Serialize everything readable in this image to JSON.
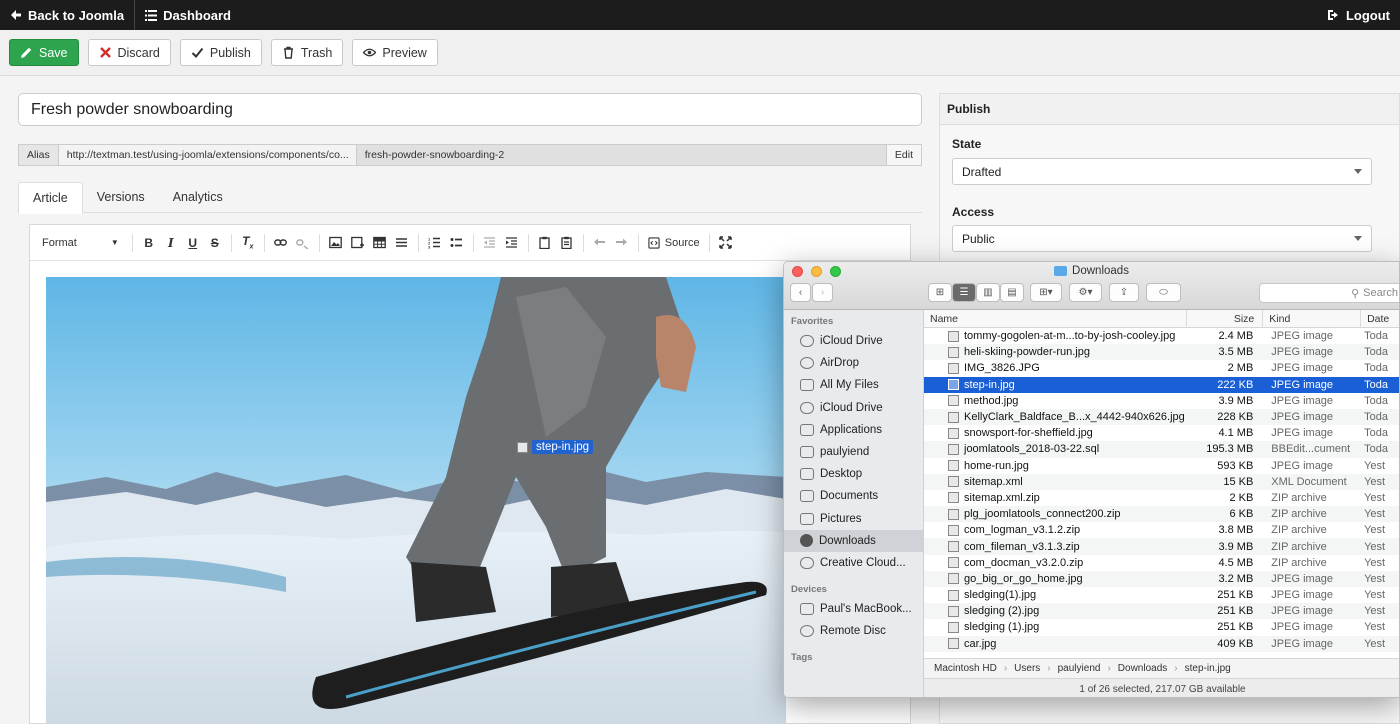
{
  "topbar": {
    "back_label": "Back to Joomla",
    "dashboard_label": "Dashboard",
    "logout_label": "Logout"
  },
  "toolbar": {
    "save_label": "Save",
    "discard_label": "Discard",
    "publish_label": "Publish",
    "trash_label": "Trash",
    "preview_label": "Preview"
  },
  "article": {
    "title": "Fresh powder snowboarding",
    "alias_label": "Alias",
    "alias_url": "http://textman.test/using-joomla/extensions/components/co...",
    "alias_slug": "fresh-powder-snowboarding-2",
    "alias_edit": "Edit"
  },
  "tabs": [
    "Article",
    "Versions",
    "Analytics"
  ],
  "editor": {
    "format_label": "Format",
    "source_label": "Source",
    "drag_file": "step-in.jpg"
  },
  "publish_panel": {
    "heading": "Publish",
    "state_label": "State",
    "state_value": "Drafted",
    "access_label": "Access",
    "access_value": "Public"
  },
  "finder": {
    "title": "Downloads",
    "search_placeholder": "Search",
    "sidebar_favorites": "Favorites",
    "sidebar_devices": "Devices",
    "sidebar_tags": "Tags",
    "favorites": [
      "iCloud Drive",
      "AirDrop",
      "All My Files",
      "iCloud Drive",
      "Applications",
      "paulyiend",
      "Desktop",
      "Documents",
      "Pictures",
      "Downloads",
      "Creative Cloud..."
    ],
    "devices": [
      "Paul's MacBook...",
      "Remote Disc"
    ],
    "columns": {
      "name": "Name",
      "size": "Size",
      "kind": "Kind",
      "date": "Date"
    },
    "files": [
      {
        "name": "tommy-gogolen-at-m...to-by-josh-cooley.jpg",
        "size": "2.4 MB",
        "kind": "JPEG image",
        "date": "Toda"
      },
      {
        "name": "heli-skiing-powder-run.jpg",
        "size": "3.5 MB",
        "kind": "JPEG image",
        "date": "Toda"
      },
      {
        "name": "IMG_3826.JPG",
        "size": "2 MB",
        "kind": "JPEG image",
        "date": "Toda"
      },
      {
        "name": "step-in.jpg",
        "size": "222 KB",
        "kind": "JPEG image",
        "date": "Toda"
      },
      {
        "name": "method.jpg",
        "size": "3.9 MB",
        "kind": "JPEG image",
        "date": "Toda"
      },
      {
        "name": "KellyClark_Baldface_B...x_4442-940x626.jpg",
        "size": "228 KB",
        "kind": "JPEG image",
        "date": "Toda"
      },
      {
        "name": "snowsport-for-sheffield.jpg",
        "size": "4.1 MB",
        "kind": "JPEG image",
        "date": "Toda"
      },
      {
        "name": "joomlatools_2018-03-22.sql",
        "size": "195.3 MB",
        "kind": "BBEdit...cument",
        "date": "Toda"
      },
      {
        "name": "home-run.jpg",
        "size": "593 KB",
        "kind": "JPEG image",
        "date": "Yest"
      },
      {
        "name": "sitemap.xml",
        "size": "15 KB",
        "kind": "XML Document",
        "date": "Yest"
      },
      {
        "name": "sitemap.xml.zip",
        "size": "2 KB",
        "kind": "ZIP archive",
        "date": "Yest"
      },
      {
        "name": "plg_joomlatools_connect200.zip",
        "size": "6 KB",
        "kind": "ZIP archive",
        "date": "Yest"
      },
      {
        "name": "com_logman_v3.1.2.zip",
        "size": "3.8 MB",
        "kind": "ZIP archive",
        "date": "Yest"
      },
      {
        "name": "com_fileman_v3.1.3.zip",
        "size": "3.9 MB",
        "kind": "ZIP archive",
        "date": "Yest"
      },
      {
        "name": "com_docman_v3.2.0.zip",
        "size": "4.5 MB",
        "kind": "ZIP archive",
        "date": "Yest"
      },
      {
        "name": "go_big_or_go_home.jpg",
        "size": "3.2 MB",
        "kind": "JPEG image",
        "date": "Yest"
      },
      {
        "name": "sledging(1).jpg",
        "size": "251 KB",
        "kind": "JPEG image",
        "date": "Yest"
      },
      {
        "name": "sledging (2).jpg",
        "size": "251 KB",
        "kind": "JPEG image",
        "date": "Yest"
      },
      {
        "name": "sledging (1).jpg",
        "size": "251 KB",
        "kind": "JPEG image",
        "date": "Yest"
      },
      {
        "name": "car.jpg",
        "size": "409 KB",
        "kind": "JPEG image",
        "date": "Yest"
      }
    ],
    "selected_index": 3,
    "path": [
      "Macintosh HD",
      "Users",
      "paulyiend",
      "Downloads",
      "step-in.jpg"
    ],
    "status": "1 of 26 selected, 217.07 GB available"
  },
  "colors": {
    "save_green": "#2ea44f",
    "selection_blue": "#1a5fd6",
    "topbar_bg": "#1c1c1c"
  }
}
